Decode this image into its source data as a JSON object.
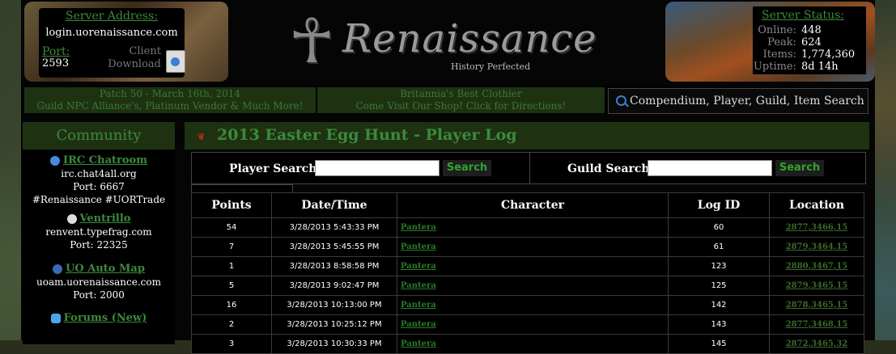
{
  "header": {
    "server_address_label": "Server Address:",
    "server_address": "login.uorenaissance.com",
    "port_label": "Port:",
    "port": "2593",
    "client_download": "Client Download",
    "logo_text": "Renaissance",
    "tagline": "History Perfected",
    "server_status_label": "Server Status:",
    "status": [
      {
        "key": "Online:",
        "value": "448"
      },
      {
        "key": "Peak:",
        "value": "624"
      },
      {
        "key": "Items:",
        "value": "1,774,360"
      },
      {
        "key": "Uptime:",
        "value": "8d 14h"
      }
    ]
  },
  "banner": {
    "patch_line1": "Patch 50 - March 16th, 2014",
    "patch_line2": "Guild NPC Alliance's, Platinum Vendor & Much More!",
    "shop_line1": "Britannia's Best Clothier",
    "shop_line2": "Come Visit Our Shop! Click for Directions!",
    "search_text": "Compendium, Player, Guild, Item Search"
  },
  "sidebar": {
    "title": "Community",
    "irc_label": "IRC Chatroom",
    "irc_server": "irc.chat4all.org",
    "irc_port": "Port: 6667",
    "irc_channels": "#Renaissance  #UORTrade",
    "vent_label": "Ventrillo",
    "vent_server": "renvent.typefrag.com",
    "vent_port": "Port: 22325",
    "uoam_label": "UO Auto Map",
    "uoam_server": "uoam.uorenaissance.com",
    "uoam_port": "Port: 2000",
    "forums_label": "Forums (New)"
  },
  "main": {
    "title": "2013 Easter Egg Hunt - Player Log",
    "player_search_label": "Player Search:",
    "guild_search_label": "Guild Search:",
    "search_button": "Search",
    "columns": [
      "Points",
      "Date/Time",
      "Character",
      "Log ID",
      "Location"
    ],
    "rows": [
      [
        "54",
        "3/28/2013 5:43:33 PM",
        "Pantera",
        "60",
        "2877,3466,15"
      ],
      [
        "7",
        "3/28/2013 5:45:55 PM",
        "Pantera",
        "61",
        "2879,3464,15"
      ],
      [
        "1",
        "3/28/2013 8:58:58 PM",
        "Pantera",
        "123",
        "2880,3467,15"
      ],
      [
        "5",
        "3/28/2013 9:02:47 PM",
        "Pantera",
        "125",
        "2879,3465,15"
      ],
      [
        "16",
        "3/28/2013 10:13:00 PM",
        "Pantera",
        "142",
        "2878,3465,15"
      ],
      [
        "2",
        "3/28/2013 10:25:12 PM",
        "Pantera",
        "143",
        "2877,3468,15"
      ],
      [
        "3",
        "3/28/2013 10:30:33 PM",
        "Pantera",
        "145",
        "2872,3465,32"
      ]
    ]
  }
}
